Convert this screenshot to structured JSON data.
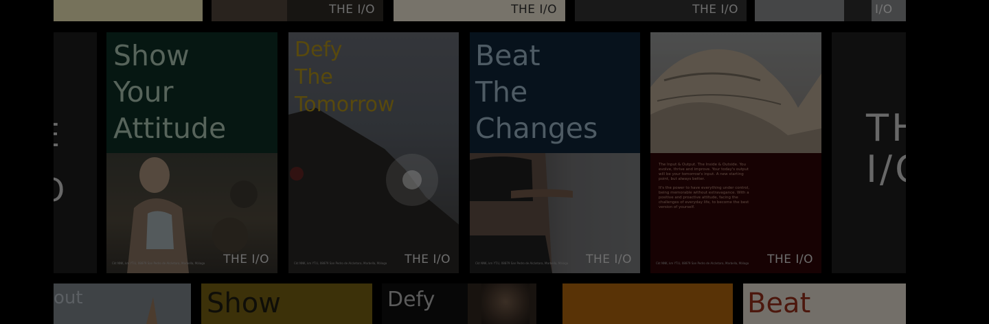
{
  "brand": "THE I/O",
  "colors": {
    "background": "#000000",
    "green_panel": "#0c2a22",
    "navy_panel": "#0d2133",
    "maroon_panel": "#2a0506",
    "gold_text": "#a08518",
    "sage_text": "#9fb7a6",
    "blue_text": "#8fa6b6"
  },
  "top_row": {
    "brand_labels": [
      "THE I/O",
      "THE I/O",
      "THE I/O",
      "THE I/O"
    ]
  },
  "middle_row": {
    "left_partial": {
      "glyphs": "E\nO"
    },
    "poster_show": {
      "headline": "Show\nYour\nAttitude",
      "brand": "THE I/O",
      "fine_print": "Ckt NNK, km YT.U, 08879 San Pedro de Alcántara, Marbella, Málaga"
    },
    "poster_defy": {
      "headline": "Defy\nThe\nTomorrow",
      "brand": "THE I/O",
      "fine_print": "Ckt NNK, km YT.U, 08879 San Pedro de Alcántara, Marbella, Málaga"
    },
    "poster_beat": {
      "headline": "Beat\nThe\nChanges",
      "brand": "THE I/O",
      "fine_print": "Ckt NNK, km YT.U, 08879 San Pedro de Alcántara, Marbella, Málaga"
    },
    "poster_text": {
      "paragraph_1": "The Input & Output. The Inside & Outside. You evolve, thrive and improve. Your today's output will be your tomorrow's input. A new starting point, but always better.",
      "paragraph_2": "It's the power to have everything under control, being memorable without extravagance. With a positive and proactive attitude, facing the challenges of everyday life, to become the best version of yourself.",
      "brand": "THE I/O",
      "fine_print": "Ckt NNK, km YT.U, 08879 San Pedro de Alcántara, Marbella, Málaga"
    },
    "right_partial": {
      "glyphs": "THE\nI/O"
    }
  },
  "bottom_row": {
    "card_1_text": "out",
    "card_2_text": "Show",
    "card_3_text": "Defy",
    "card_6_text": "Beat"
  }
}
